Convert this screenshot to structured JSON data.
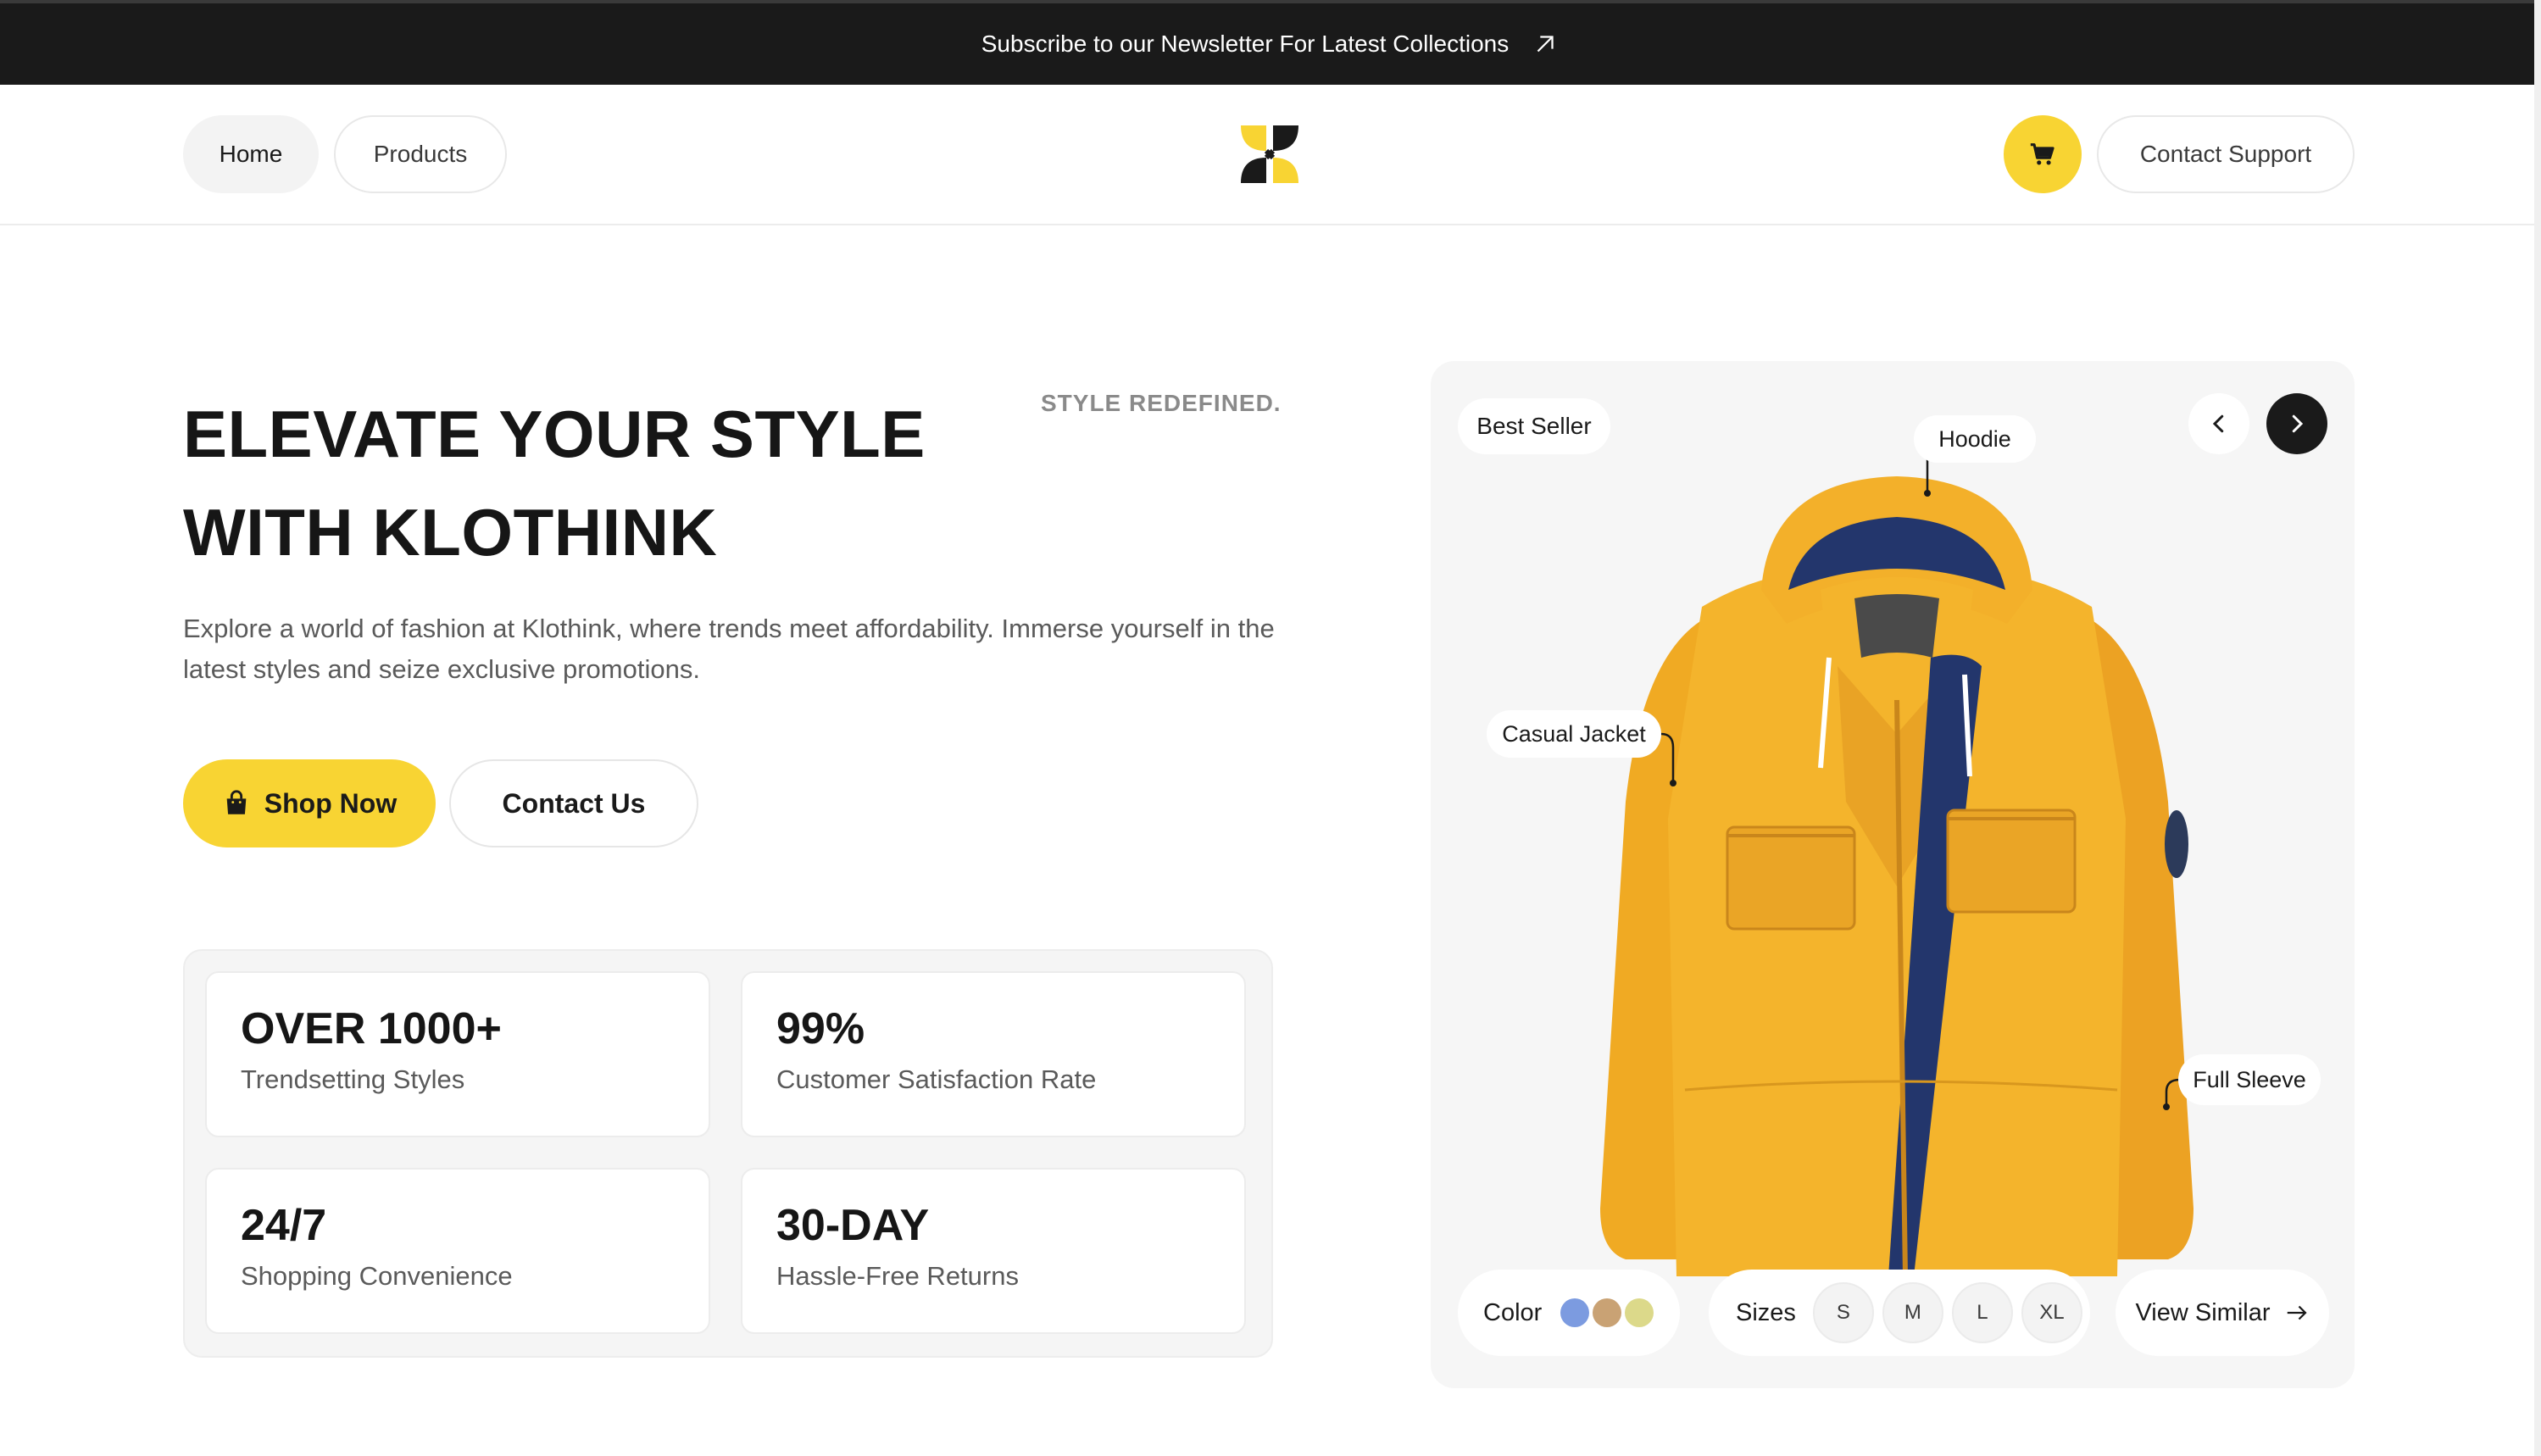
{
  "announcement": {
    "text": "Subscribe to our Newsletter For Latest Collections",
    "icon": "arrow-up-right-icon"
  },
  "header": {
    "nav": [
      {
        "label": "Home",
        "active": true
      },
      {
        "label": "Products",
        "active": false
      }
    ],
    "logo": "klothink-logo",
    "cart_icon": "cart-icon",
    "support_label": "Contact Support"
  },
  "hero": {
    "title": "ELEVATE YOUR STYLE WITH KLOTHINK",
    "tagline": "STYLE REDEFINED.",
    "description": "Explore a world of fashion at Klothink, where trends meet affordability. Immerse yourself in the latest styles and seize exclusive promotions.",
    "primary_button": "Shop Now",
    "secondary_button": "Contact Us"
  },
  "stats": [
    {
      "value": "OVER 1000+",
      "label": "Trendsetting Styles"
    },
    {
      "value": "99%",
      "label": "Customer Satisfaction Rate"
    },
    {
      "value": "24/7",
      "label": "Shopping Convenience"
    },
    {
      "value": "30-DAY",
      "label": "Hassle-Free Returns"
    }
  ],
  "product": {
    "badge": "Best Seller",
    "callouts": {
      "hoodie": "Hoodie",
      "casual": "Casual Jacket",
      "sleeve": "Full Sleeve"
    },
    "color_label": "Color",
    "colors": [
      "#7c9be0",
      "#c9a274",
      "#dcd98a"
    ],
    "sizes_label": "Sizes",
    "sizes": [
      "S",
      "M",
      "L",
      "XL"
    ],
    "view_similar": "View Similar",
    "accent": "#f8d433"
  }
}
